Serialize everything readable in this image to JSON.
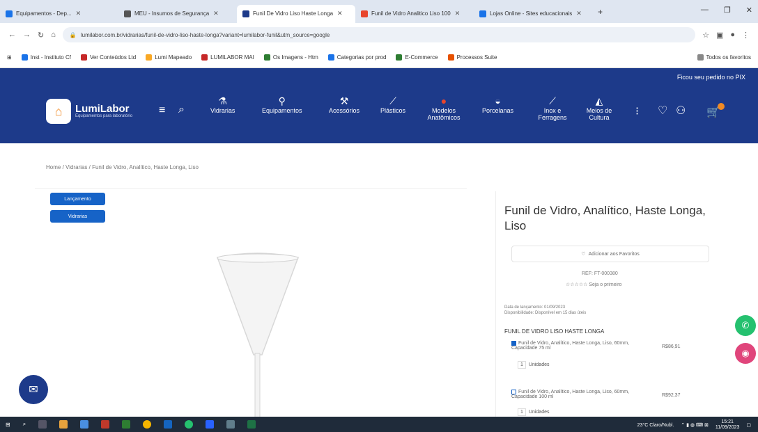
{
  "browser": {
    "tabs": [
      {
        "label": "Equipamentos - Dep...",
        "color": "#1a73e8"
      },
      {
        "label": "MEU - Insumos de Segurança",
        "color": "#555555"
      },
      {
        "label": "Funil De Vidro Liso Haste Longa",
        "color": "#1d3a8a",
        "active": true
      },
      {
        "label": "Funil de Vidro Analitico Liso 100",
        "color": "#e8452c"
      },
      {
        "label": "Lojas Online - Sites educacionais",
        "color": "#1a73e8"
      }
    ],
    "url": "lumilabor.com.br/vidrarias/funil-de-vidro-liso-haste-longa?variant=lumilabor-funil&utm_source=google",
    "bookmarks": [
      "Inst - Instituto Cf",
      "Ver Conteúdos Ltd",
      "Lumi Mapeado",
      "LUMILABOR MAI",
      "Os Imagens - Htm",
      "Categorias por prod",
      "E-Commerce",
      "Processos Suite",
      "Todos os favoritos"
    ]
  },
  "header": {
    "promo": "Ficou seu pedido no PIX",
    "logo_text": "LumiLabor",
    "logo_sub": "Equipamentos para laboratório",
    "menu": [
      {
        "label": "Vidrarias",
        "icon": "flask-icon"
      },
      {
        "label": "Equipamentos",
        "icon": "microscope-icon"
      },
      {
        "label": "Acessórios",
        "icon": "tools-icon"
      },
      {
        "label": "Plásticos",
        "icon": "pipette-icon"
      },
      {
        "label": "Modelos Anatômicos",
        "icon": "anatomy-icon"
      },
      {
        "label": "Porcelanas",
        "icon": "mortar-icon"
      },
      {
        "label": "Inox e Ferragens",
        "icon": "tongs-icon"
      },
      {
        "label": "Meios de Cultura",
        "icon": "culture-icon"
      }
    ]
  },
  "breadcrumb": "Home  /  Vidrarias  /  Funil de Vidro, Analítico, Haste Longa, Liso",
  "tags": [
    "Lançamento",
    "Vidrarias"
  ],
  "product": {
    "title": "Funil de Vidro, Analítico, Haste Longa, Liso",
    "favorite_label": "Adicionar aos Favoritos",
    "ref": "REF: FT-000380",
    "rating": "☆☆☆☆☆  Seja o primeiro",
    "meta_1": "Data de lançamento: 01/09/2023",
    "meta_2": "Disponibilidade: Disponível em 15 dias úteis",
    "variant_title": "FUNIL DE VIDRO LISO HASTE LONGA",
    "options": [
      {
        "label": "Funil de Vidro, Analítico, Haste Longa, Liso, 60mm, Capacidade 75 ml",
        "price": "R$86,91",
        "qty": "1",
        "unit": "Unidades",
        "checked": true
      },
      {
        "label": "Funil de Vidro, Analítico, Haste Longa, Liso, 60mm, Capacidade 100 ml",
        "price": "R$92,37",
        "qty": "1",
        "unit": "Unidades",
        "checked": false
      }
    ]
  },
  "taskbar": {
    "weather": "23°C  Claro/Nubl.",
    "time": "15:21",
    "date": "11/09/2023"
  }
}
